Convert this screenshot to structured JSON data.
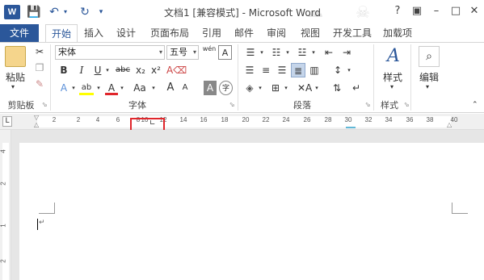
{
  "titlebar": {
    "app_logo": "W",
    "title": "文档1 [兼容模式] - Microsoft Word",
    "qat": [
      "save-icon",
      "undo-icon",
      "redo-icon",
      "customize-icon"
    ],
    "window_buttons": [
      "?",
      "▣",
      "–",
      "□",
      "✕"
    ]
  },
  "tabs": [
    "文件",
    "开始",
    "插入",
    "设计",
    "页面布局",
    "引用",
    "邮件",
    "审阅",
    "视图",
    "开发工具",
    "加载项"
  ],
  "ribbon": {
    "clipboard": {
      "paste": "粘贴",
      "label": "剪贴板"
    },
    "font": {
      "name": "宋体",
      "size": "五号",
      "wen": "wén",
      "A": "A",
      "label": "字体",
      "bold": "B",
      "italic": "I",
      "underline": "U",
      "strike": "abc",
      "sub": "x₂",
      "sup": "x²",
      "aa": "Aa",
      "grow": "A",
      "shrink": "A",
      "shade": "A",
      "circle": "字"
    },
    "paragraph": {
      "label": "段落"
    },
    "styles": {
      "button": "样式",
      "label": "样式"
    },
    "editing": {
      "button": "编辑"
    }
  },
  "ruler": {
    "numbers": [
      "2",
      "2",
      "4",
      "6",
      "8",
      "10",
      "12",
      "14",
      "16",
      "18",
      "20",
      "22",
      "24",
      "26",
      "28",
      "30",
      "32",
      "34",
      "36",
      "38",
      "40"
    ],
    "tab_selector": "L"
  },
  "vruler": {
    "numbers": [
      "4",
      "2",
      "1",
      "2"
    ]
  },
  "colors": {
    "accent": "#2b579a",
    "highlight_border": "#e0262b"
  }
}
